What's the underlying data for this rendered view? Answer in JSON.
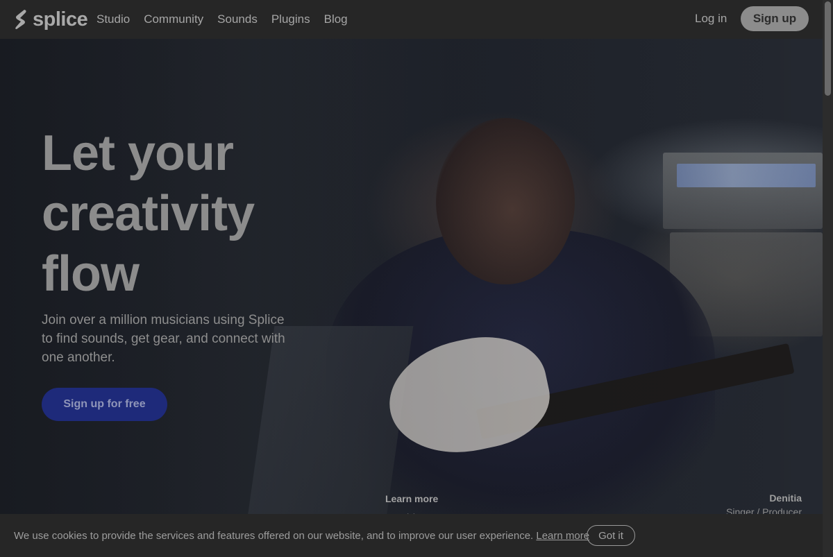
{
  "brand": {
    "name": "splice"
  },
  "nav": {
    "links": [
      "Studio",
      "Community",
      "Sounds",
      "Plugins",
      "Blog"
    ],
    "login": "Log in",
    "signup": "Sign up"
  },
  "hero": {
    "headline_lines": [
      "Let your",
      "creativity",
      "flow"
    ],
    "subhead": "Join over a million musicians using Splice to find sounds, get gear, and connect with one another.",
    "cta": "Sign up for free",
    "learn_more": "Learn more",
    "credit": {
      "name": "Denitia",
      "role": "Singer / Producer"
    }
  },
  "cookie": {
    "text": "We use cookies to provide the services and features offered on our website, and to improve our user experience.",
    "link": "Learn more",
    "button": "Got it"
  },
  "colors": {
    "cta": "#1e2a7a",
    "nav": "#262626"
  }
}
